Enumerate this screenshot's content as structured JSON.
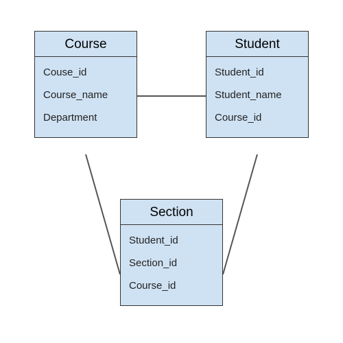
{
  "diagram_type": "entity-relationship",
  "entities": [
    {
      "name": "Course",
      "attributes": [
        "Couse_id",
        "Course_name",
        "Department"
      ]
    },
    {
      "name": "Student",
      "attributes": [
        "Student_id",
        "Student_name",
        "Course_id"
      ]
    },
    {
      "name": "Section",
      "attributes": [
        "Student_id",
        "Section_id",
        "Course_id"
      ]
    }
  ],
  "relationships": [
    {
      "from": "Course",
      "to": "Student"
    },
    {
      "from": "Course",
      "to": "Section"
    },
    {
      "from": "Student",
      "to": "Section"
    }
  ],
  "colors": {
    "entity_fill": "#cfe2f3",
    "entity_border": "#333333",
    "connector": "#555555"
  }
}
